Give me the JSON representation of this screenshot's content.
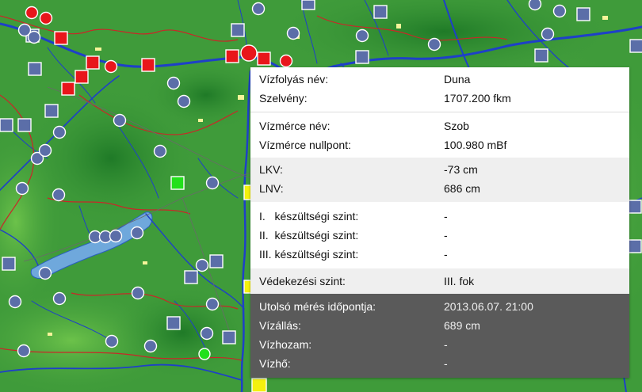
{
  "map": {
    "lake_color": "#6fa8dc",
    "river_color": "#1e40c8",
    "border_color": "#c82828",
    "station_blue": "#5b6ea8",
    "station_red": "#e8161b",
    "station_green": "#22e01b",
    "station_yellow": "#f4f10e"
  },
  "popup": {
    "watercourse_label": "Vízfolyás név:",
    "watercourse_value": "Duna",
    "section_label": "Szelvény:",
    "section_value": "1707.200 fkm",
    "gauge_name_label": "Vízmérce név:",
    "gauge_name_value": "Szob",
    "gauge_zero_label": "Vízmérce nullpont:",
    "gauge_zero_value": "100.980 mBf",
    "lkv_label": "LKV:",
    "lkv_value": "-73 cm",
    "lnv_label": "LNV:",
    "lnv_value": "686 cm",
    "level1_label": "I.   készültségi szint:",
    "level1_value": "-",
    "level2_label": "II.  készültségi szint:",
    "level2_value": "-",
    "level3_label": "III. készültségi szint:",
    "level3_value": "-",
    "defense_label": "Védekezési szint:",
    "defense_value": "III. fok",
    "last_measure_label": "Utolsó mérés időpontja:",
    "last_measure_value": "2013.06.07. 21:00",
    "water_level_label": "Vízállás:",
    "water_level_value": "689 cm",
    "discharge_label": "Vízhozam:",
    "discharge_value": "-",
    "water_temp_label": "Vízhő:",
    "water_temp_value": "-"
  }
}
